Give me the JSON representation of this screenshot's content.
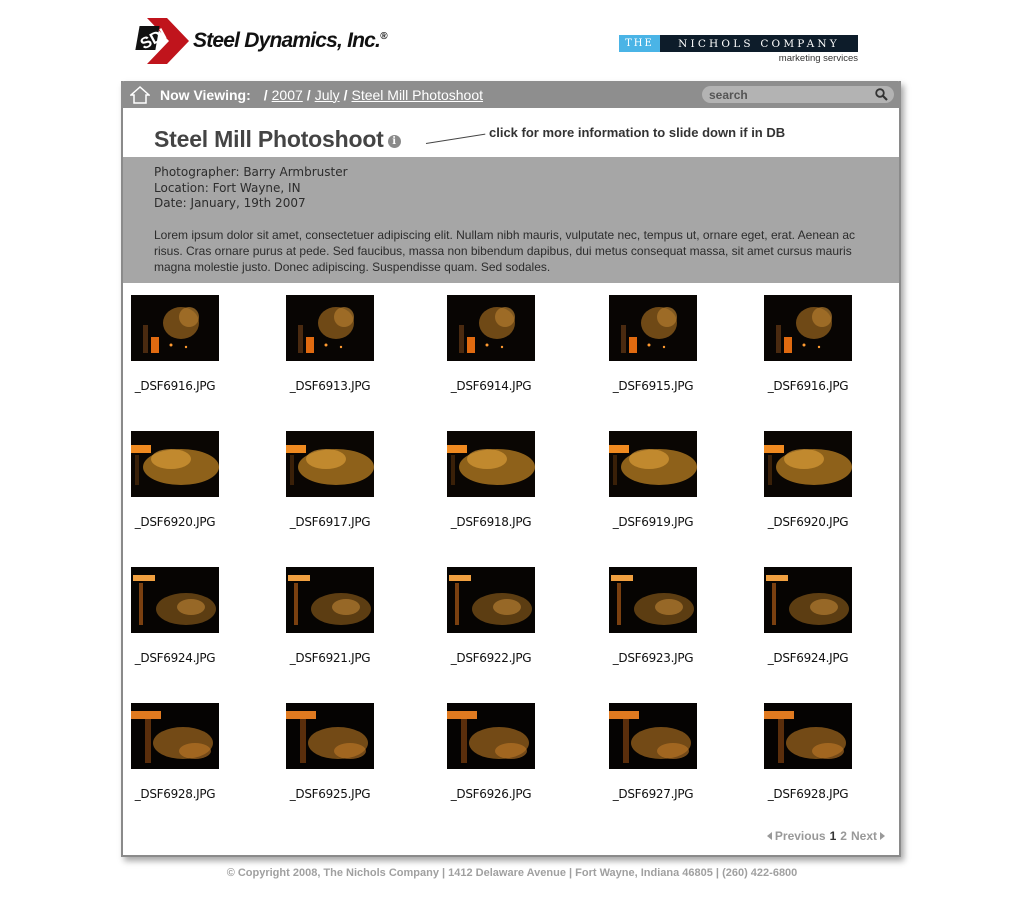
{
  "header": {
    "sdi_logo_mark": "SDI",
    "sdi_logo_text": "Steel Dynamics, Inc.",
    "sdi_reg": "®",
    "nichols_the": "THE",
    "nichols_name": "NICHOLS COMPANY",
    "nichols_sub": "marketing services"
  },
  "nav": {
    "label": "Now Viewing:",
    "crumbs": [
      "2007",
      "July",
      "Steel Mill Photoshoot"
    ],
    "separator": "/",
    "search_placeholder": "search"
  },
  "album": {
    "title": "Steel Mill Photoshoot",
    "info_glyph": "i",
    "annotation": "click for more information to slide down if in DB",
    "photographer": "Photographer: Barry Armbruster",
    "location": "Location: Fort Wayne, IN",
    "date": "Date: January, 19th 2007",
    "description": "Lorem ipsum dolor sit amet, consectetuer adipiscing elit. Nullam nibh mauris, vulputate nec, tempus ut, ornare eget, erat. Aenean ac risus. Cras ornare purus at pede. Sed faucibus, massa non bibendum dapibus, dui metus consequat massa, sit amet cursus mauris magna molestie justo. Donec adipiscing. Suspendisse quam. Sed sodales."
  },
  "thumbnails": [
    "_DSF6916.JPG",
    "_DSF6913.JPG",
    "_DSF6914.JPG",
    "_DSF6915.JPG",
    "_DSF6916.JPG",
    "_DSF6920.JPG",
    "_DSF6917.JPG",
    "_DSF6918.JPG",
    "_DSF6919.JPG",
    "_DSF6920.JPG",
    "_DSF6924.JPG",
    "_DSF6921.JPG",
    "_DSF6922.JPG",
    "_DSF6923.JPG",
    "_DSF6924.JPG",
    "_DSF6928.JPG",
    "_DSF6925.JPG",
    "_DSF6926.JPG",
    "_DSF6927.JPG",
    "_DSF6928.JPG"
  ],
  "pager": {
    "previous": "Previous",
    "current": "1",
    "page2": "2",
    "next": "Next"
  },
  "footer": {
    "text": "© Copyright 2008, The Nichols Company | 1412 Delaware Avenue | Fort Wayne, Indiana 46805 | (260) 422-6800"
  },
  "colors": {
    "navbar": "#8e8e8e",
    "details_panel": "#a6a6a6",
    "sdi_red": "#c0141c",
    "nichols_blue": "#4ab4e6",
    "nichols_navy": "#0d1c2a"
  }
}
